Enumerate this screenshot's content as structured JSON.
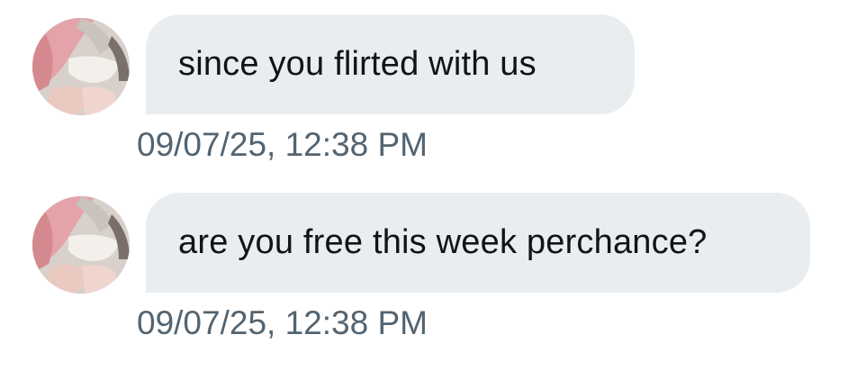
{
  "conversation": {
    "messages": [
      {
        "text": "since you flirted with us",
        "timestamp": "09/07/25, 12:38 PM",
        "avatar": "user-avatar"
      },
      {
        "text": "are you free this week perchance?",
        "timestamp": "09/07/25, 12:38 PM",
        "avatar": "user-avatar"
      }
    ]
  },
  "colors": {
    "bubble_background": "#e9edf0",
    "message_text": "#0f1419",
    "timestamp_text": "#536471",
    "page_background": "#ffffff"
  }
}
